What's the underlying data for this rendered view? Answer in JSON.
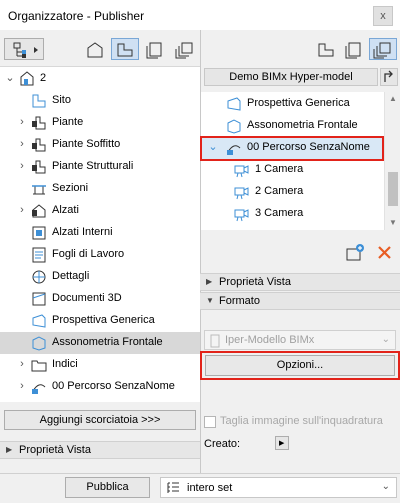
{
  "window": {
    "title": "Organizzatore - Publisher",
    "close_glyph": "x"
  },
  "left_tree": {
    "rows": [
      {
        "label": "2",
        "icon": "project-icon",
        "expander": "expanded"
      },
      {
        "label": "Sito",
        "icon": "story-icon",
        "expander": "none"
      },
      {
        "label": "Piante",
        "icon": "plan-icon",
        "expander": "collapsed"
      },
      {
        "label": "Piante Soffitto",
        "icon": "plan-icon",
        "expander": "collapsed"
      },
      {
        "label": "Piante Strutturali",
        "icon": "plan-icon",
        "expander": "collapsed"
      },
      {
        "label": "Sezioni",
        "icon": "section-icon",
        "expander": "none"
      },
      {
        "label": "Alzati",
        "icon": "elevation-icon",
        "expander": "collapsed"
      },
      {
        "label": "Alzati Interni",
        "icon": "interior-elevation-icon",
        "expander": "none"
      },
      {
        "label": "Fogli di Lavoro",
        "icon": "worksheet-icon",
        "expander": "none"
      },
      {
        "label": "Dettagli",
        "icon": "detail-icon",
        "expander": "none"
      },
      {
        "label": "Documenti 3D",
        "icon": "document-3d-icon",
        "expander": "none"
      },
      {
        "label": "Prospettiva Generica",
        "icon": "perspective-icon",
        "expander": "none"
      },
      {
        "label": "Assonometria Frontale",
        "icon": "axonometry-icon",
        "expander": "none",
        "selected": true
      },
      {
        "label": "Indici",
        "icon": "folder-icon",
        "expander": "collapsed"
      },
      {
        "label": "00 Percorso SenzaNome",
        "icon": "camera-path-icon",
        "expander": "collapsed"
      }
    ],
    "add_shortcut_label": "Aggiungi scorciatoia >>>",
    "view_properties_label": "Proprietà Vista"
  },
  "right_panel": {
    "set_name": "Demo BIMx Hyper-model",
    "items": [
      {
        "label": "Prospettiva Generica",
        "icon": "perspective-icon",
        "indent": 0
      },
      {
        "label": "Assonometria Frontale",
        "icon": "axonometry-icon",
        "indent": 0
      },
      {
        "label": "00 Percorso SenzaNome",
        "icon": "camera-path-icon",
        "indent": 0,
        "selected": true
      },
      {
        "label": "1 Camera",
        "icon": "camera-icon",
        "indent": 1
      },
      {
        "label": "2 Camera",
        "icon": "camera-icon",
        "indent": 1
      },
      {
        "label": "3 Camera",
        "icon": "camera-icon",
        "indent": 1
      }
    ],
    "view_properties_label": "Proprietà Vista",
    "format_label": "Formato",
    "format_value": "Iper-Modello BIMx",
    "options_label": "Opzioni...",
    "crop_label": "Taglia immagine sull'inquadratura",
    "created_label": "Creato:"
  },
  "footer": {
    "publish_label": "Pubblica",
    "set_dropdown_value": "intero set"
  },
  "colors": {
    "highlight_red": "#e2231a",
    "selection_blue": "#3d8fd6",
    "active_tab": "#cfe0f3"
  }
}
